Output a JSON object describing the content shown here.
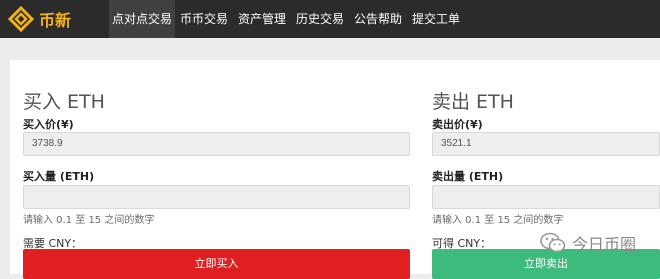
{
  "brand": {
    "name": "币新"
  },
  "nav": {
    "items": [
      {
        "label": "点对点交易",
        "active": true
      },
      {
        "label": "币币交易",
        "active": false
      },
      {
        "label": "资产管理",
        "active": false
      },
      {
        "label": "历史交易",
        "active": false
      },
      {
        "label": "公告帮助",
        "active": false
      },
      {
        "label": "提交工单",
        "active": false
      }
    ]
  },
  "buy": {
    "title": "买入 ETH",
    "price_label": "买入价(¥)",
    "price_value": "3738.9",
    "amount_label": "买入量 (ETH)",
    "amount_value": "",
    "hint": "请输入 0.1 至 15 之间的数字",
    "total_label": "需要 CNY：",
    "button_label": "立即买入",
    "button_color": "#e02020"
  },
  "sell": {
    "title": "卖出 ETH",
    "price_label": "卖出价(¥)",
    "price_value": "3521.1",
    "amount_label": "卖出量 (ETH)",
    "amount_value": "",
    "hint": "请输入 0.1 至 15 之间的数字",
    "total_label": "可得 CNY：",
    "button_label": "立即卖出",
    "button_color": "#3dbb7c"
  },
  "watermark": {
    "text": "今日币圈"
  },
  "colors": {
    "navbar_bg": "#2b2b2b",
    "brand": "#f3b21a",
    "page_bg": "#ececec"
  }
}
